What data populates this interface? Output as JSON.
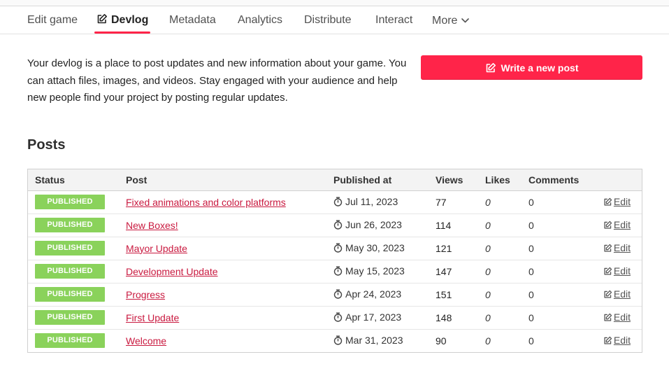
{
  "nav": {
    "tabs": [
      {
        "label": "Edit game"
      },
      {
        "label": "Devlog"
      },
      {
        "label": "Metadata"
      },
      {
        "label": "Analytics"
      },
      {
        "label": "Distribute"
      },
      {
        "label": "Interact"
      },
      {
        "label": "More"
      }
    ],
    "active_tab": "Devlog"
  },
  "intro": {
    "text": "Your devlog is a place to post updates and new information about your game. You can attach files, images, and videos. Stay engaged with your audience and help new people find your project by posting regular updates."
  },
  "write_button": {
    "label": "Write a new post"
  },
  "posts": {
    "title": "Posts",
    "columns": [
      "Status",
      "Post",
      "Published at",
      "Views",
      "Likes",
      "Comments"
    ],
    "rows": [
      {
        "status": "PUBLISHED",
        "title": "Fixed animations and color platforms",
        "published": "Jul 11, 2023",
        "views": "77",
        "likes": "0",
        "comments": "0",
        "edit": "Edit"
      },
      {
        "status": "PUBLISHED",
        "title": "New Boxes!",
        "published": "Jun 26, 2023",
        "views": "114",
        "likes": "0",
        "comments": "0",
        "edit": "Edit"
      },
      {
        "status": "PUBLISHED",
        "title": "Mayor Update",
        "published": "May 30, 2023",
        "views": "121",
        "likes": "0",
        "comments": "0",
        "edit": "Edit"
      },
      {
        "status": "PUBLISHED",
        "title": "Development Update",
        "published": "May 15, 2023",
        "views": "147",
        "likes": "0",
        "comments": "0",
        "edit": "Edit"
      },
      {
        "status": "PUBLISHED",
        "title": "Progress",
        "published": "Apr 24, 2023",
        "views": "151",
        "likes": "0",
        "comments": "0",
        "edit": "Edit"
      },
      {
        "status": "PUBLISHED",
        "title": "First Update",
        "published": "Apr 17, 2023",
        "views": "148",
        "likes": "0",
        "comments": "0",
        "edit": "Edit"
      },
      {
        "status": "PUBLISHED",
        "title": "Welcome",
        "published": "Mar 31, 2023",
        "views": "90",
        "likes": "0",
        "comments": "0",
        "edit": "Edit"
      }
    ]
  },
  "colors": {
    "accent": "#ff2449",
    "published_badge": "#8ad25b",
    "post_link": "#c9193f"
  },
  "icons": {
    "devlog_tab": "edit-icon",
    "more_tab": "chevron-down-icon",
    "write_button": "edit-icon",
    "published_at": "stopwatch-icon",
    "edit_link": "edit-icon"
  }
}
